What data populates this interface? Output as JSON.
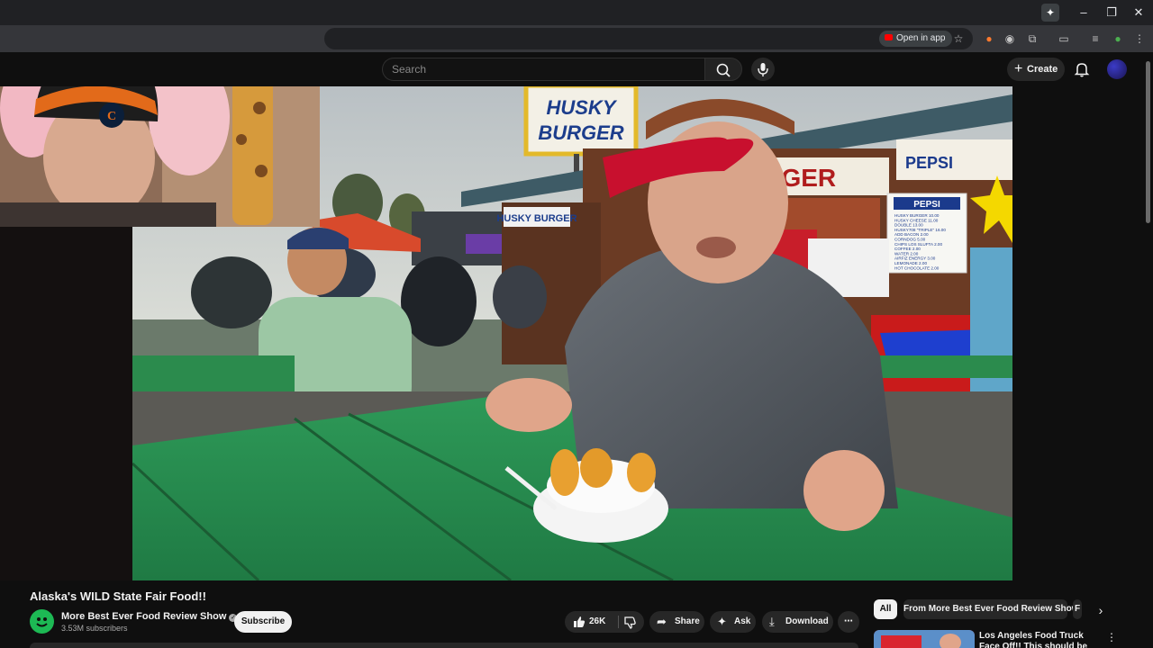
{
  "browser": {
    "open_in_app_label": "Open in app",
    "window_buttons": [
      "–",
      "❐",
      "✕"
    ],
    "extension_icons": [
      "star-icon",
      "fire-icon",
      "spark-icon",
      "puzzle-icon",
      "cast-icon",
      "media-icon",
      "profile-icon",
      "kebab-icon"
    ]
  },
  "masthead": {
    "search_placeholder": "Search",
    "create_label": "Create"
  },
  "video": {
    "title": "Alaska's WILD State Fair Food!!",
    "scene_signs": {
      "husky_burger_main": "HUSKY\nBURGER",
      "husky_burger_small": "HUSKY BURGER",
      "burger_banner": "URGER",
      "pepsi": "PEPSI"
    },
    "menu_board": [
      "HUSKY BURGER  10.00",
      "HUSKY CHEESE  11.00",
      "DOUBLE  13.00",
      "HUSKY708 \"TRIPLE\"  16.00",
      "ADD BACON  2.00",
      "CORNDOG  5.00",
      "CHIPS LOS SLUFTA  2.00",
      "COFFEE  2.00",
      "WATER  2.00",
      "AIRFIZ ENERGY  3.00",
      "LEMONADE  2.00",
      "HOT CHOCOLATE  2.00"
    ]
  },
  "channel": {
    "name": "More Best Ever Food Review Show",
    "subscribers": "3.53M subscribers",
    "subscribe_label": "Subscribe"
  },
  "actions": {
    "likes": "26K",
    "share_label": "Share",
    "ask_label": "Ask",
    "download_label": "Download"
  },
  "sidebar": {
    "chips": [
      "All",
      "From More Best Ever Food Review Show",
      "F"
    ],
    "recommendation_title": "Los Angeles Food Truck Face Off!! This should be ILLEGAL!!"
  },
  "colors": {
    "background": "#0f0f0f",
    "youtube_red": "#ff0000",
    "pill": "#272727",
    "bench_green": "#2f8f52",
    "bandana_red": "#c8102e"
  }
}
